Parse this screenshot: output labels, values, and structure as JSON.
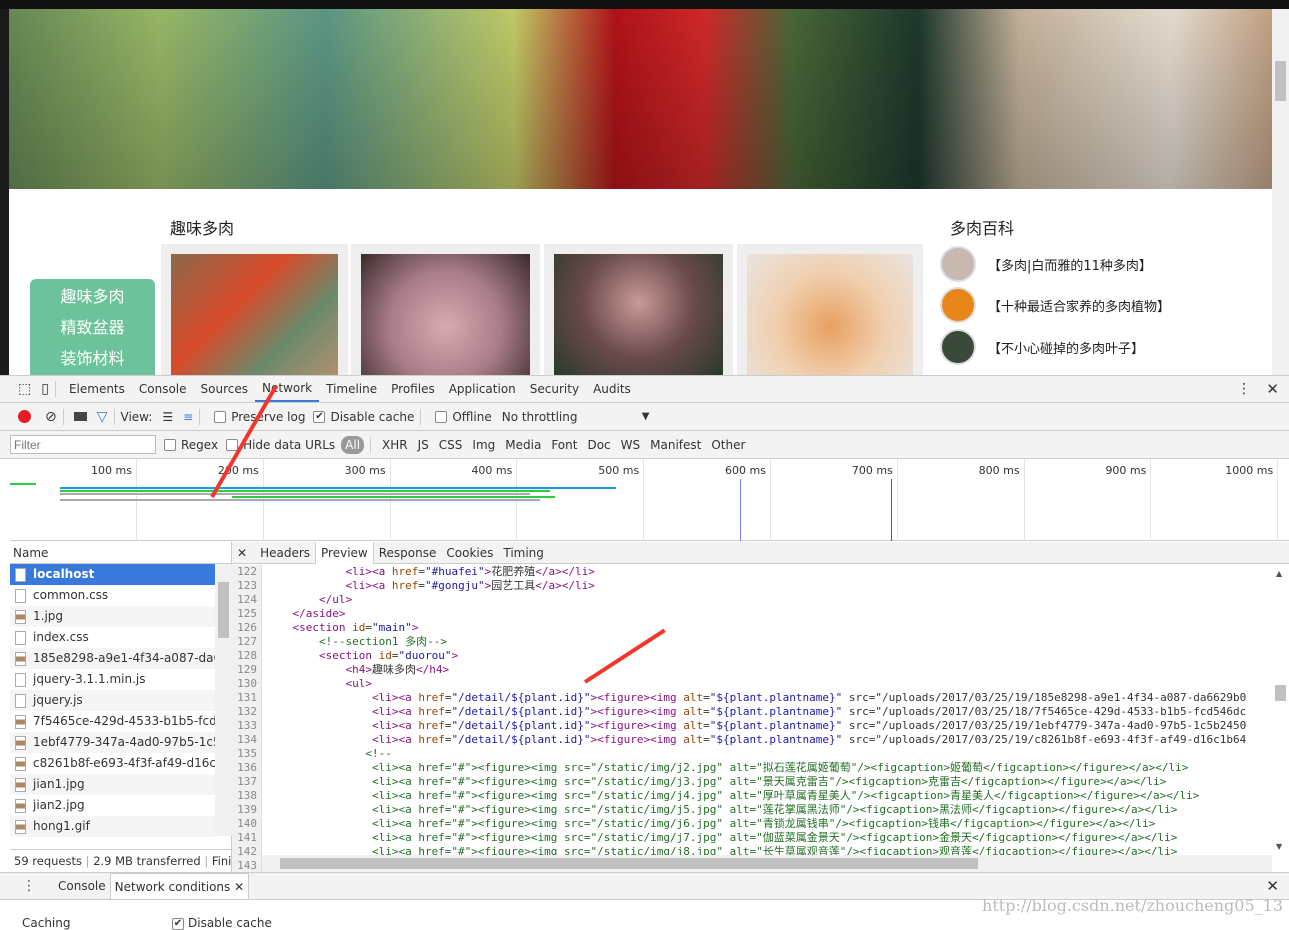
{
  "page": {
    "section_title": "趣味多肉",
    "side_menu": [
      "趣味多肉",
      "精致盆器",
      "装饰材料"
    ],
    "wiki_title": "多肉百科",
    "wiki_items": [
      "【多肉|白而雅的11种多肉】",
      "【十种最适合家养的多肉植物】",
      "【不小心碰掉的多肉叶子】"
    ]
  },
  "devtools": {
    "tabs": [
      "Elements",
      "Console",
      "Sources",
      "Network",
      "Timeline",
      "Profiles",
      "Application",
      "Security",
      "Audits"
    ],
    "active_tab": "Network",
    "toolbar": {
      "view_label": "View:",
      "preserve_log": "Preserve log",
      "preserve_log_checked": false,
      "disable_cache": "Disable cache",
      "disable_cache_checked": true,
      "offline": "Offline",
      "offline_checked": false,
      "throttling": "No throttling"
    },
    "filter": {
      "placeholder": "Filter",
      "regex": "Regex",
      "hide_data_urls": "Hide data URLs",
      "types": [
        "All",
        "XHR",
        "JS",
        "CSS",
        "Img",
        "Media",
        "Font",
        "Doc",
        "WS",
        "Manifest",
        "Other"
      ],
      "active_type": "All"
    },
    "timeline_ticks": [
      "100 ms",
      "200 ms",
      "300 ms",
      "400 ms",
      "500 ms",
      "600 ms",
      "700 ms",
      "800 ms",
      "900 ms",
      "1000 ms"
    ],
    "names_header": "Name",
    "requests": [
      {
        "name": "localhost",
        "type": "doc"
      },
      {
        "name": "common.css",
        "type": "doc"
      },
      {
        "name": "1.jpg",
        "type": "img"
      },
      {
        "name": "index.css",
        "type": "doc"
      },
      {
        "name": "185e8298-a9e1-4f34-a087-da6629b0",
        "type": "img"
      },
      {
        "name": "jquery-3.1.1.min.js",
        "type": "doc"
      },
      {
        "name": "jquery.js",
        "type": "doc"
      },
      {
        "name": "7f5465ce-429d-4533-b1b5-fcd546dc",
        "type": "img"
      },
      {
        "name": "1ebf4779-347a-4ad0-97b5-1c5b2450",
        "type": "img"
      },
      {
        "name": "c8261b8f-e693-4f3f-af49-d16c1b64",
        "type": "img"
      },
      {
        "name": "jian1.jpg",
        "type": "img"
      },
      {
        "name": "jian2.jpg",
        "type": "img"
      },
      {
        "name": "hong1.gif",
        "type": "img"
      }
    ],
    "selected_request": "localhost",
    "status": {
      "requests": "59 requests",
      "transferred": "2.9 MB transferred",
      "finish": "Fini..."
    },
    "detail_tabs": [
      "Headers",
      "Preview",
      "Response",
      "Cookies",
      "Timing"
    ],
    "active_detail_tab": "Preview",
    "code_lines": [
      {
        "n": "122",
        "t": "            <li><a href=\"#huafei\">花肥养殖</a></li>"
      },
      {
        "n": "123",
        "t": "            <li><a href=\"#gongju\">园艺工具</a></li>"
      },
      {
        "n": "124",
        "t": "        </ul>"
      },
      {
        "n": "125",
        "t": "    </aside>"
      },
      {
        "n": "126",
        "t": "    <section id=\"main\">"
      },
      {
        "n": "127",
        "t": "        <!--section1 多肉-->",
        "c": true
      },
      {
        "n": "128",
        "t": "        <section id=\"duorou\">"
      },
      {
        "n": "129",
        "t": "            <h4>趣味多肉</h4>"
      },
      {
        "n": "130",
        "t": "            <ul>"
      },
      {
        "n": "131",
        "t": "                <li><a href=\"/detail/${plant.id}\"><figure><img alt=\"${plant.plantname}\" src=\"/uploads/2017/03/25/19/185e8298-a9e1-4f34-a087-da6629b0"
      },
      {
        "n": "132",
        "t": "                <li><a href=\"/detail/${plant.id}\"><figure><img alt=\"${plant.plantname}\" src=\"/uploads/2017/03/25/18/7f5465ce-429d-4533-b1b5-fcd546dc"
      },
      {
        "n": "133",
        "t": "                <li><a href=\"/detail/${plant.id}\"><figure><img alt=\"${plant.plantname}\" src=\"/uploads/2017/03/25/19/1ebf4779-347a-4ad0-97b5-1c5b2450"
      },
      {
        "n": "134",
        "t": "                <li><a href=\"/detail/${plant.id}\"><figure><img alt=\"${plant.plantname}\" src=\"/uploads/2017/03/25/19/c8261b8f-e693-4f3f-af49-d16c1b64"
      },
      {
        "n": "135",
        "t": "               <!--",
        "c": true
      },
      {
        "n": "136",
        "t": "                <li><a href=\"#\"><figure><img src=\"/static/img/j2.jpg\" alt=\"拟石莲花属姬葡萄\"/><figcaption>姬葡萄</figcaption></figure></a></li>",
        "c": true
      },
      {
        "n": "137",
        "t": "                <li><a href=\"#\"><figure><img src=\"/static/img/j3.jpg\" alt=\"景天属克雷吉\"/><figcaption>克雷吉</figcaption></figure></a></li>",
        "c": true
      },
      {
        "n": "138",
        "t": "                <li><a href=\"#\"><figure><img src=\"/static/img/j4.jpg\" alt=\"厚叶草属青星美人\"/><figcaption>青星美人</figcaption></figure></a></li>",
        "c": true
      },
      {
        "n": "139",
        "t": "                <li><a href=\"#\"><figure><img src=\"/static/img/j5.jpg\" alt=\"莲花掌属黑法师\"/><figcaption>黑法师</figcaption></figure></a></li>",
        "c": true
      },
      {
        "n": "140",
        "t": "                <li><a href=\"#\"><figure><img src=\"/static/img/j6.jpg\" alt=\"青锁龙属钱串\"/><figcaption>钱串</figcaption></figure></a></li>",
        "c": true
      },
      {
        "n": "141",
        "t": "                <li><a href=\"#\"><figure><img src=\"/static/img/j7.jpg\" alt=\"伽蓝菜属金景天\"/><figcaption>金景天</figcaption></figure></a></li>",
        "c": true
      },
      {
        "n": "142",
        "t": "                <li><a href=\"#\"><figure><img src=\"/static/img/j8.jpg\" alt=\"长生草属观音莲\"/><figcaption>观音莲</figcaption></figure></a></li>",
        "c": true
      },
      {
        "n": "143",
        "t": ""
      }
    ],
    "drawer": {
      "tabs": [
        "Console",
        "Network conditions"
      ],
      "active": "Network conditions",
      "caching_label": "Caching",
      "disable_cache": "Disable cache"
    }
  },
  "watermark": "http://blog.csdn.net/zhoucheng05_13",
  "colors": {
    "accent": "#3879d9",
    "side_menu": "#6cc39b",
    "record": "#e51c23",
    "annotation_arrow": "#f2362b"
  }
}
